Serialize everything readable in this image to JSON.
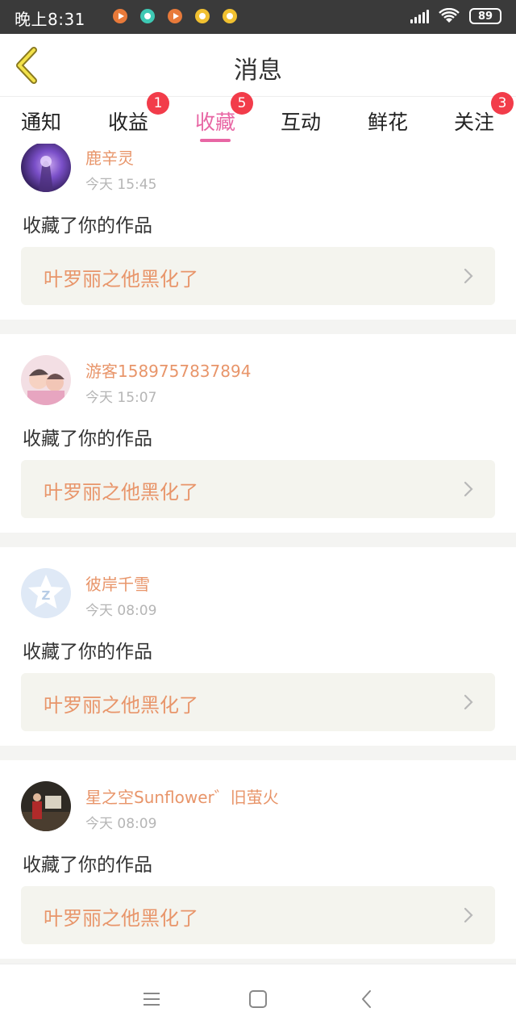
{
  "status_bar": {
    "time": "晚上8:31",
    "battery": "89",
    "app_icons": [
      {
        "icon": "video-app-icon",
        "color": "#e87a3a"
      },
      {
        "icon": "chat-app-icon",
        "color": "#3ec9b4"
      },
      {
        "icon": "video-app-icon",
        "color": "#e87a3a"
      },
      {
        "icon": "reader-app-icon",
        "color": "#f0c030"
      },
      {
        "icon": "reader-app-icon",
        "color": "#f0c030"
      }
    ]
  },
  "header": {
    "title": "消息",
    "back_icon": "chevron-left-icon"
  },
  "tabs": [
    {
      "label": "通知",
      "badge": ""
    },
    {
      "label": "收益",
      "badge": "1"
    },
    {
      "label": "收藏",
      "badge": "5",
      "active": true
    },
    {
      "label": "互动",
      "badge": ""
    },
    {
      "label": "鲜花",
      "badge": ""
    },
    {
      "label": "关注",
      "badge": "3"
    }
  ],
  "items": [
    {
      "user": "鹿辛灵",
      "time": "今天 15:45",
      "action": "收藏了你的作品",
      "work": "叶罗丽之他黑化了"
    },
    {
      "user": "游客1589757837894",
      "time": "今天 15:07",
      "action": "收藏了你的作品",
      "work": "叶罗丽之他黑化了"
    },
    {
      "user": "彼岸千雪",
      "time": "今天 08:09",
      "action": "收藏了你的作品",
      "work": "叶罗丽之他黑化了"
    },
    {
      "user": "星之空Sunflower゛旧萤火",
      "time": "今天 08:09",
      "action": "收藏了你的作品",
      "work": "叶罗丽之他黑化了"
    }
  ],
  "colors": {
    "accent": "#e866a4",
    "badge": "#f23c4a",
    "username": "#e8956a",
    "work_box_bg": "#f4f4ee"
  },
  "bottom_nav": {
    "menu_icon": "menu-icon",
    "home_icon": "home-square-icon",
    "back_icon": "back-triangle-icon"
  }
}
